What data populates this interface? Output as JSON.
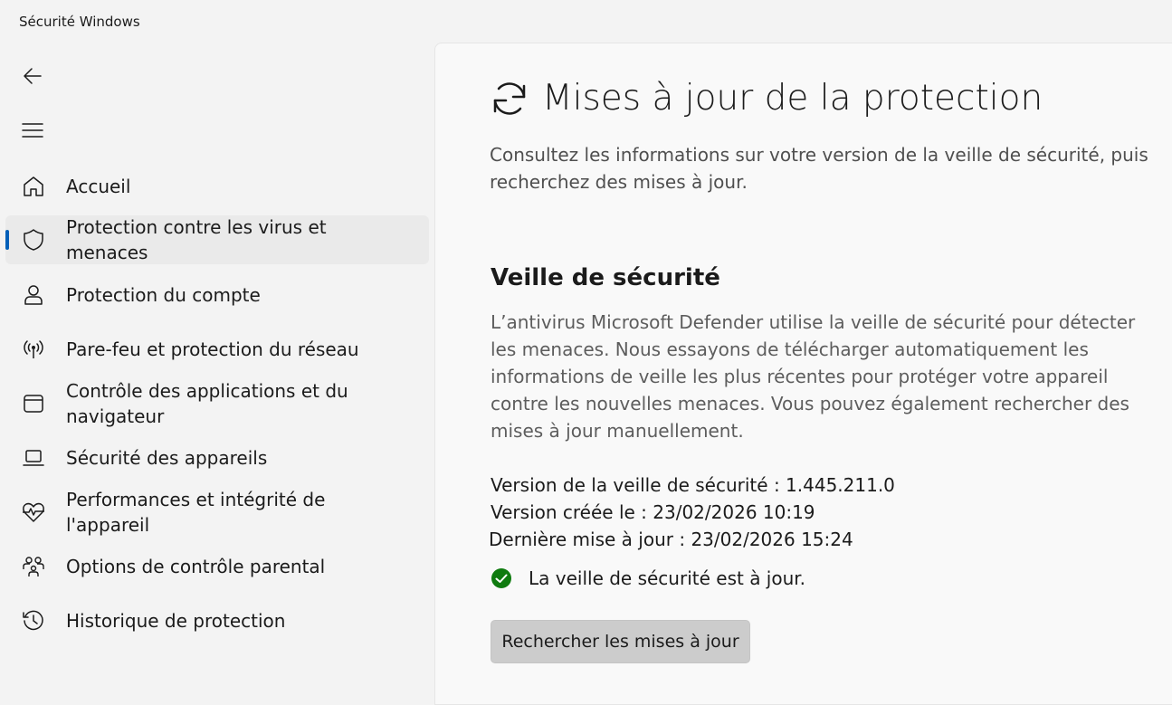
{
  "window": {
    "title": "Sécurité Windows"
  },
  "sidebar": {
    "back_icon": "back-arrow-icon",
    "menu_icon": "hamburger-menu-icon",
    "items": [
      {
        "label": "Accueil",
        "icon": "home-icon",
        "selected": false
      },
      {
        "label": "Protection contre les virus et menaces",
        "icon": "shield-icon",
        "selected": true
      },
      {
        "label": "Protection du compte",
        "icon": "person-icon",
        "selected": false
      },
      {
        "label": "Pare-feu et protection du réseau",
        "icon": "wireless-signal-icon",
        "selected": false
      },
      {
        "label": "Contrôle des applications et du navigateur",
        "icon": "browser-window-icon",
        "selected": false
      },
      {
        "label": "Sécurité des appareils",
        "icon": "laptop-icon",
        "selected": false
      },
      {
        "label": "Performances et intégrité de l'appareil",
        "icon": "heart-pulse-icon",
        "selected": false
      },
      {
        "label": "Options de contrôle parental",
        "icon": "family-icon",
        "selected": false
      },
      {
        "label": "Historique de protection",
        "icon": "history-icon",
        "selected": false
      }
    ]
  },
  "main": {
    "header_icon": "sync-icon",
    "title": "Mises à jour de la protection",
    "description": "Consultez les informations sur votre version de la veille de sécurité, puis recherchez des mises à jour.",
    "section": {
      "title": "Veille de sécurité",
      "description": "L’antivirus Microsoft Defender utilise la veille de sécurité pour détecter les menaces. Nous essayons de télécharger automatiquement les informations de veille les plus récentes pour protéger votre appareil contre les nouvelles menaces. Vous pouvez également rechercher des mises à jour manuellement.",
      "version_line": "Version de la veille de sécurité : 1.445.211.0",
      "created_line": "Version créée le : 23/02/2026 10:19",
      "last_update_line": "Dernière mise à jour : 23/02/2026 15:24",
      "status_icon": "check-circle-icon",
      "status_text": "La veille de sécurité est à jour.",
      "check_button_label": "Rechercher les mises à jour"
    }
  },
  "colors": {
    "accent": "#005fb8",
    "success": "#0f7b0f",
    "background": "#f3f3f3",
    "content_background": "#f9f9f9",
    "button_background": "#cccccc"
  }
}
